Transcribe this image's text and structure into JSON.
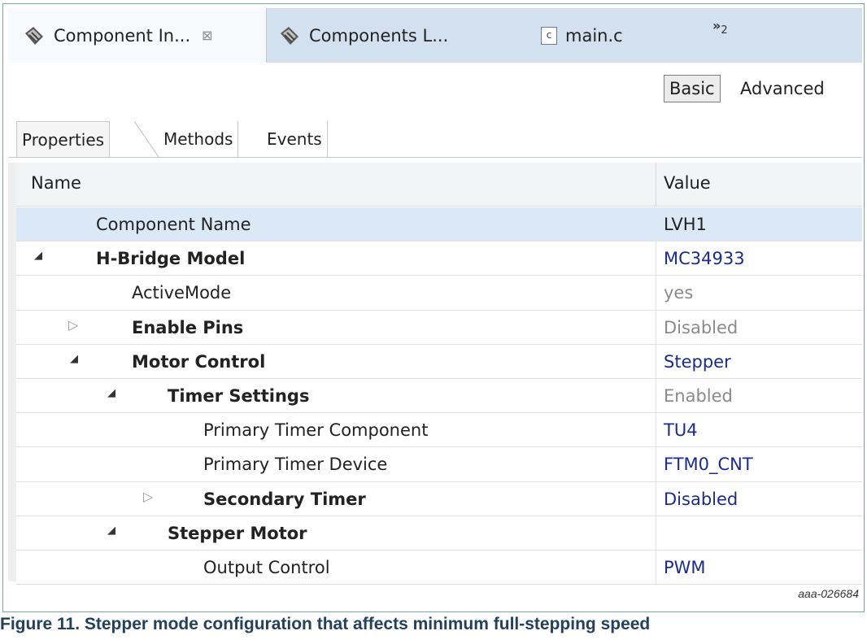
{
  "tabs": [
    {
      "label": "Component In...",
      "icon": "component-gear-icon",
      "active": true,
      "close": "⊠"
    },
    {
      "label": "Components L...",
      "icon": "component-gear-icon",
      "active": false
    },
    {
      "label": "main.c",
      "icon": "c-file-icon",
      "active": false
    },
    {
      "label": "»",
      "count": "2"
    }
  ],
  "mode": {
    "basic": "Basic",
    "advanced": "Advanced"
  },
  "subtabs": [
    "Properties",
    "Methods",
    "Events"
  ],
  "table": {
    "header": {
      "name": "Name",
      "value": "Value"
    },
    "rows": [
      {
        "name": "Component Name",
        "value": "LVH1",
        "bold": false,
        "twisty": "",
        "level": 0
      },
      {
        "name": "H-Bridge Model",
        "value": "MC34933",
        "bold": true,
        "twisty": "expanded",
        "level": 0
      },
      {
        "name": "ActiveMode",
        "value": "yes",
        "bold": false,
        "twisty": "",
        "level": 1
      },
      {
        "name": "Enable Pins",
        "value": "Disabled",
        "bold": true,
        "twisty": "collapsed",
        "level": 1
      },
      {
        "name": "Motor Control",
        "value": "Stepper",
        "bold": true,
        "twisty": "expanded",
        "level": 1
      },
      {
        "name": "Timer Settings",
        "value": "Enabled",
        "bold": true,
        "twisty": "expanded",
        "level": 2
      },
      {
        "name": "Primary Timer Component",
        "value": "TU4",
        "bold": false,
        "twisty": "",
        "level": 3
      },
      {
        "name": "Primary Timer Device",
        "value": "FTM0_CNT",
        "bold": false,
        "twisty": "",
        "level": 3
      },
      {
        "name": "Secondary Timer",
        "value": "Disabled",
        "bold": true,
        "twisty": "collapsed",
        "level": 3
      },
      {
        "name": "Stepper Motor",
        "value": "",
        "bold": true,
        "twisty": "expanded",
        "level": 2
      },
      {
        "name": "Output Control",
        "value": "PWM",
        "bold": false,
        "twisty": "",
        "level": 3
      }
    ]
  },
  "figure_id": "aaa-026684",
  "caption": "Figure 11. Stepper mode configuration that affects minimum full-stepping speed",
  "colors": {
    "tabbar": "#d2e0f0",
    "selected_row": "#dbe8f6",
    "value_blue": "#1b2c8c",
    "value_gray": "#8a8a8a",
    "caption": "#23405f"
  }
}
